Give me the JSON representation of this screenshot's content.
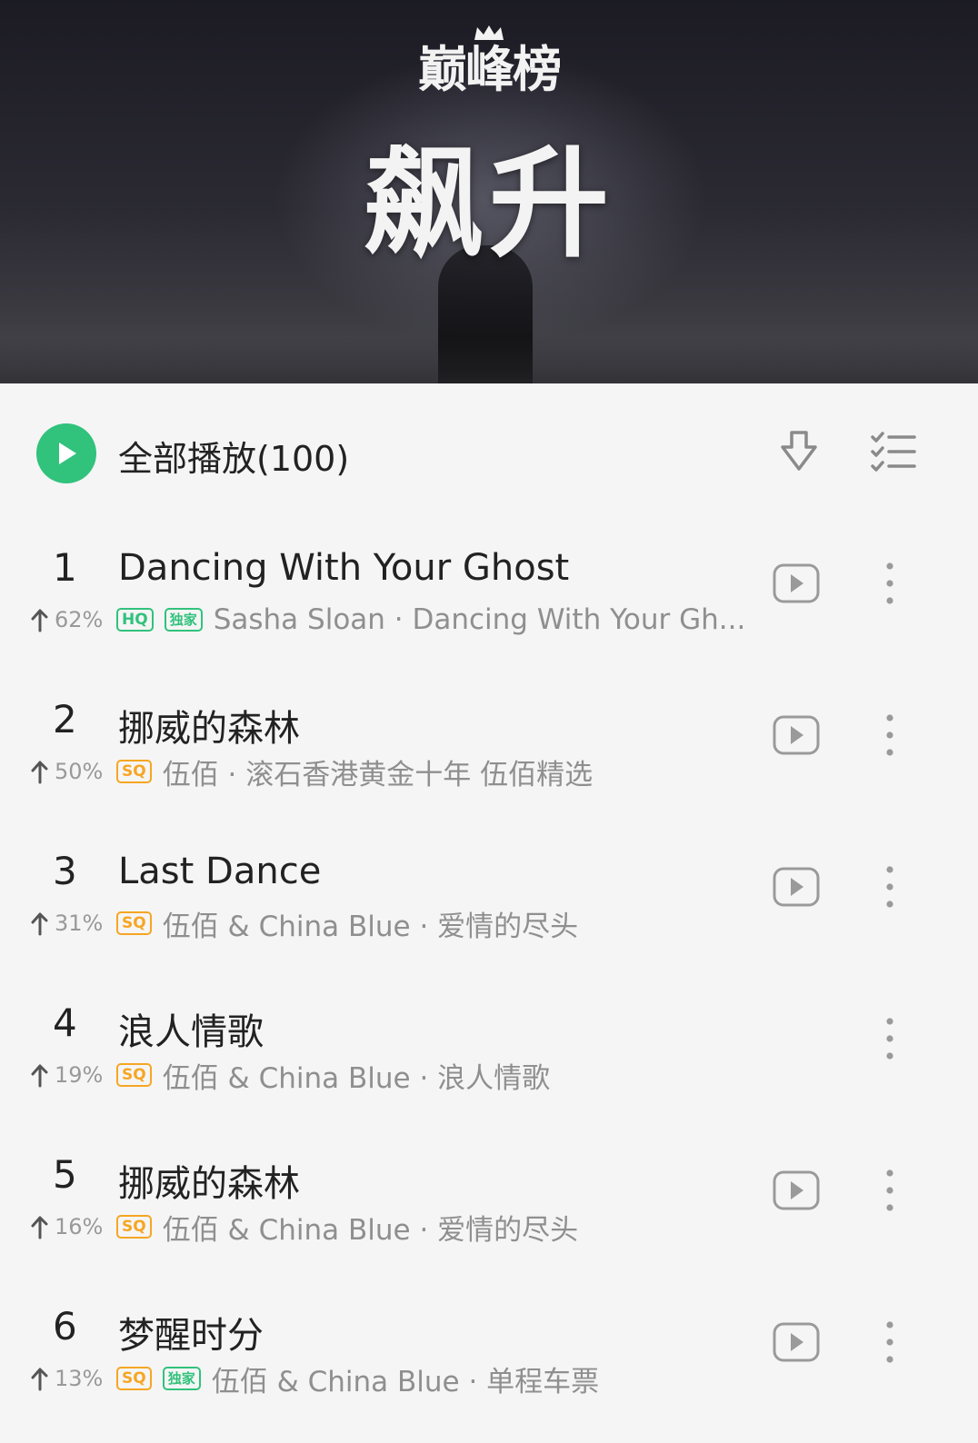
{
  "banner": {
    "logo_text": "巅峰榜",
    "title": "飙升"
  },
  "play_all": {
    "label": "全部播放(100)"
  },
  "colors": {
    "accent": "#31c27c",
    "sq": "#f6a623",
    "secondary_text": "#8f8f8f"
  },
  "songs": [
    {
      "rank": "1",
      "title": "Dancing With Your Ghost",
      "trend": "62%",
      "badges": [
        "HQ",
        "独家"
      ],
      "subtitle": "Sasha Sloan · Dancing With Your Gh...",
      "has_mv": true
    },
    {
      "rank": "2",
      "title": "挪威的森林",
      "trend": "50%",
      "badges": [
        "SQ"
      ],
      "subtitle": "伍佰 · 滚石香港黄金十年 伍佰精选",
      "has_mv": true
    },
    {
      "rank": "3",
      "title": "Last Dance",
      "trend": "31%",
      "badges": [
        "SQ"
      ],
      "subtitle": "伍佰 & China Blue · 爱情的尽头",
      "has_mv": true
    },
    {
      "rank": "4",
      "title": "浪人情歌",
      "trend": "19%",
      "badges": [
        "SQ"
      ],
      "subtitle": "伍佰 & China Blue · 浪人情歌",
      "has_mv": false
    },
    {
      "rank": "5",
      "title": "挪威的森林",
      "trend": "16%",
      "badges": [
        "SQ"
      ],
      "subtitle": "伍佰 & China Blue · 爱情的尽头",
      "has_mv": true
    },
    {
      "rank": "6",
      "title": "梦醒时分",
      "trend": "13%",
      "badges": [
        "SQ",
        "独家"
      ],
      "subtitle": "伍佰 & China Blue · 单程车票",
      "has_mv": true
    }
  ]
}
